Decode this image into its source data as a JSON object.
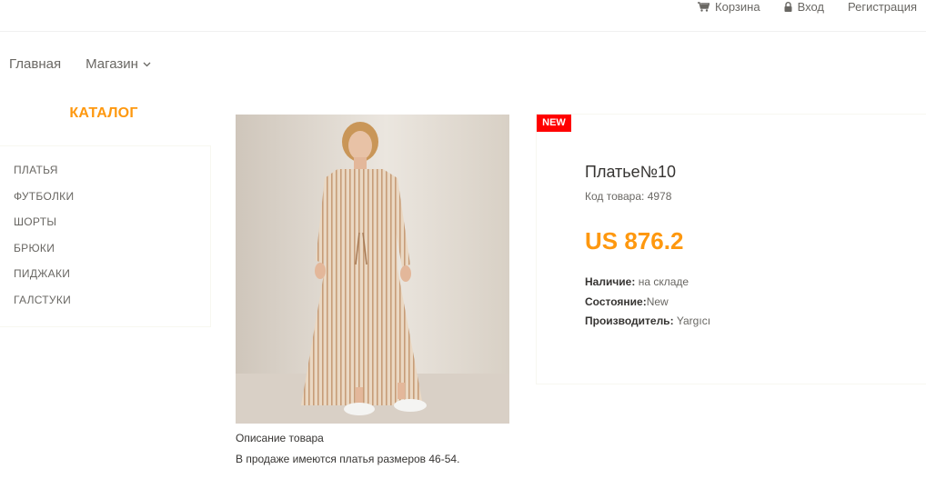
{
  "header": {
    "links": [
      {
        "icon": "cart-icon",
        "label": "Корзина"
      },
      {
        "icon": "lock-icon",
        "label": "Вход"
      },
      {
        "label": "Регистрация"
      }
    ]
  },
  "nav": {
    "home": "Главная",
    "shop": "Магазин"
  },
  "sidebar": {
    "title": "КАТАЛОГ",
    "items": [
      "ПЛАТЬЯ",
      "ФУТБОЛКИ",
      "ШОРТЫ",
      "БРЮКИ",
      "ПИДЖАКИ",
      "ГАЛСТУКИ"
    ]
  },
  "product": {
    "badge": "NEW",
    "name": "Платье№10",
    "code_label": "Код товара: 4978",
    "price": "US 876.2",
    "availability_label": "Наличие:",
    "availability_value": " на складе",
    "condition_label": "Состояние:",
    "condition_value": "New",
    "brand_label": "Производитель:",
    "brand_value": " Yargıcı",
    "description_title": "Описание товара",
    "description_text": "В продаже имеются платья размеров 46-54."
  },
  "colors": {
    "accent": "#fe980f",
    "badge": "#ff0000",
    "text": "#696763"
  }
}
